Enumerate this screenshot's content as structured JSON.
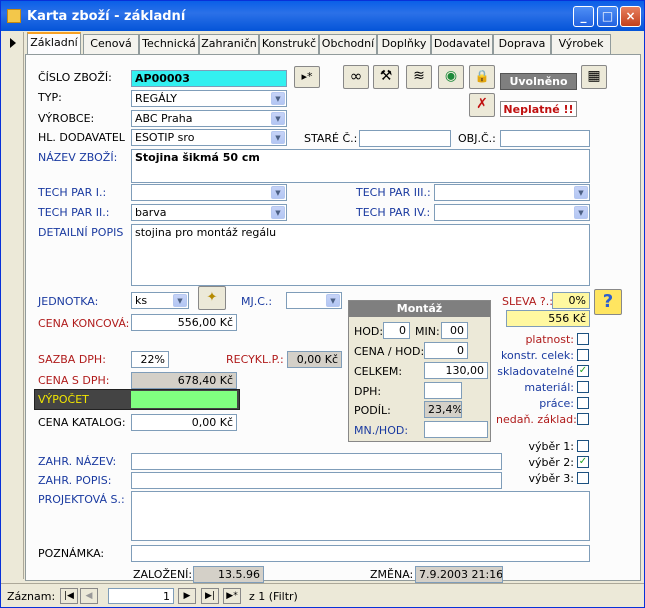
{
  "window": {
    "title": "Karta zboží - základní",
    "minimize": "_",
    "maximize": "□",
    "close": "×"
  },
  "tabs": [
    "Základní",
    "Cenová",
    "Technická",
    "Zahraničn",
    "Konstrukč",
    "Obchodní",
    "Doplňky",
    "Dodavatel",
    "Doprava",
    "Výrobek"
  ],
  "labels": {
    "cislo": "ČÍSLO ZBOŽÍ:",
    "typ": "TYP:",
    "vyrobce": "VÝROBCE:",
    "hl_dod": "HL. DODAVATEL",
    "stare": "STARÉ Č.:",
    "objc": "OBJ.Č.:",
    "nazev": "NÁZEV ZBOŽÍ:",
    "tp1": "TECH PAR I.:",
    "tp2": "TECH PAR II.:",
    "tp3": "TECH PAR III.:",
    "tp4": "TECH PAR IV.:",
    "detail": "DETAILNÍ POPIS",
    "jednotka": "JEDNOTKA:",
    "mjc": "MJ.C.:",
    "cena_konc": "CENA KONCOVÁ:",
    "sazba": "SAZBA DPH:",
    "recykl": "RECYKL.P.:",
    "cena_dph": "CENA S DPH:",
    "vypocet": "VÝPOČET",
    "cena_kat": "CENA KATALOG:",
    "zahr_nazev": "ZAHR. NÁZEV:",
    "zahr_popis": "ZAHR. POPIS:",
    "projekt": "PROJEKTOVÁ S.:",
    "poznamka": "POZNÁMKA:",
    "zalozeni": "ZALOŽENÍ:",
    "zmena": "ZMĚNA:",
    "sleva": "SLEVA ?.:"
  },
  "values": {
    "cislo": "AP00003",
    "typ": "REGÁLY",
    "vyrobce": "ABC Praha",
    "hl_dod": "ESOTIP sro",
    "stare": "",
    "objc": "",
    "nazev": "Stojina šikmá 50 cm",
    "tp1": "",
    "tp2": "barva",
    "tp3": "",
    "tp4": "",
    "detail": "stojina pro montáž regálu",
    "jednotka": "ks",
    "mjc": "",
    "cena_konc": "556,00 Kč",
    "sazba": "22%",
    "recykl": "0,00 Kč",
    "cena_dph": "678,40 Kč",
    "vypocet": "",
    "cena_kat": "0,00 Kč",
    "zahr_nazev": "",
    "zahr_popis": "",
    "projekt": "",
    "poznamka": "",
    "zalozeni": "13.5.96",
    "zmena": "7.9.2003 21:16",
    "sleva_pct": "0%",
    "sleva_val": "556 Kč"
  },
  "status": {
    "uvolneno": "Uvolněno",
    "neplatne": "Neplatné !!"
  },
  "montaz": {
    "title": "Montáž",
    "hod_l": "HOD:",
    "hod": "0",
    "min_l": "MIN:",
    "min": "00",
    "cena_hod_l": "CENA / HOD:",
    "cena_hod": "0",
    "celkem_l": "CELKEM:",
    "celkem": "130,00",
    "dph_l": "DPH:",
    "dph": "",
    "podil_l": "PODÍL:",
    "podil": "23,4%",
    "mnhod_l": "MN./HOD:",
    "mnhod": ""
  },
  "flags": [
    {
      "label": "platnost:",
      "checked": ""
    },
    {
      "label": "konstr. celek:",
      "checked": ""
    },
    {
      "label": "skladovatelné",
      "checked": "✓"
    },
    {
      "label": "materiál:",
      "checked": ""
    },
    {
      "label": "práce:",
      "checked": ""
    },
    {
      "label": "nedaň. základ:",
      "checked": ""
    }
  ],
  "vybery": [
    {
      "label": "výběr 1:",
      "checked": ""
    },
    {
      "label": "výběr 2:",
      "checked": "✓"
    },
    {
      "label": "výběr 3:",
      "checked": ""
    }
  ],
  "nav": {
    "label": "Záznam:",
    "current": "1",
    "total": "z  1 (Filtr)"
  },
  "icons": {
    "next_rec": "▸*",
    "glasses": "∞",
    "tools": "⚒",
    "map": "≋",
    "globe": "◉",
    "lock": "🔒",
    "calc": "▦",
    "help": "?",
    "notok": "✗",
    "wand": "✦"
  }
}
